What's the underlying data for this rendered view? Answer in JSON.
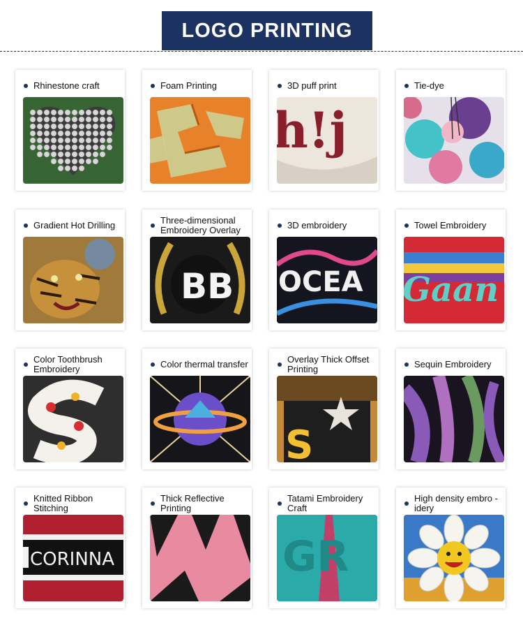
{
  "header": {
    "title": "LOGO PRINTING"
  },
  "cards": [
    {
      "label": "Rhinestone craft",
      "image": "rhinestone-heart"
    },
    {
      "label": "Foam Printing",
      "image": "foam-print"
    },
    {
      "label": "3D puff print",
      "image": "puff-print"
    },
    {
      "label": "Tie-dye",
      "image": "tie-dye-shorts"
    },
    {
      "label": "Gradient Hot Drilling",
      "image": "tiger-hot-drilling"
    },
    {
      "label": "Three-dimensional Embroidery Overlay",
      "image": "bb-embroidery-overlay"
    },
    {
      "label": "3D embroidery",
      "image": "ocean-3d-embroidery"
    },
    {
      "label": "Towel Embroidery",
      "image": "towel-embroidery"
    },
    {
      "label": "Color Toothbrush Embroidery",
      "image": "toothbrush-embroidery"
    },
    {
      "label": "Color thermal transfer",
      "image": "planet-thermal-transfer"
    },
    {
      "label": "Overlay Thick Offset Printing",
      "image": "star-offset-printing"
    },
    {
      "label": "Sequin Embroidery",
      "image": "sequin-embroidery"
    },
    {
      "label": "Knitted Ribbon Stitching",
      "image": "corinna-ribbon"
    },
    {
      "label": "Thick Reflective Printing",
      "image": "reflective-print"
    },
    {
      "label": "Tatami Embroidery Craft",
      "image": "tatami-embroidery"
    },
    {
      "label": "High density embro -idery",
      "image": "flower-high-density"
    }
  ]
}
